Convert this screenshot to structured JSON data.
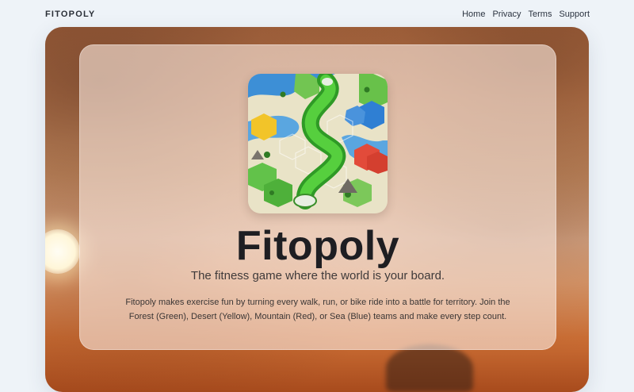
{
  "header": {
    "brand": "FITOPOLY",
    "nav": [
      {
        "label": "Home"
      },
      {
        "label": "Privacy"
      },
      {
        "label": "Terms"
      },
      {
        "label": "Support"
      }
    ]
  },
  "hero": {
    "icon": "game-board-map-icon",
    "title": "Fitopoly",
    "tagline": "The fitness game where the world is your board.",
    "description": "Fitopoly makes exercise fun by turning every walk, run, or bike ride into a battle for territory. Join the Forest (Green), Desert (Yellow), Mountain (Red), or Sea (Blue) teams and make every step count."
  },
  "colors": {
    "forest": "#3fae3a",
    "desert": "#f2c429",
    "mountain": "#e24b3a",
    "sea": "#2f7fd3"
  }
}
